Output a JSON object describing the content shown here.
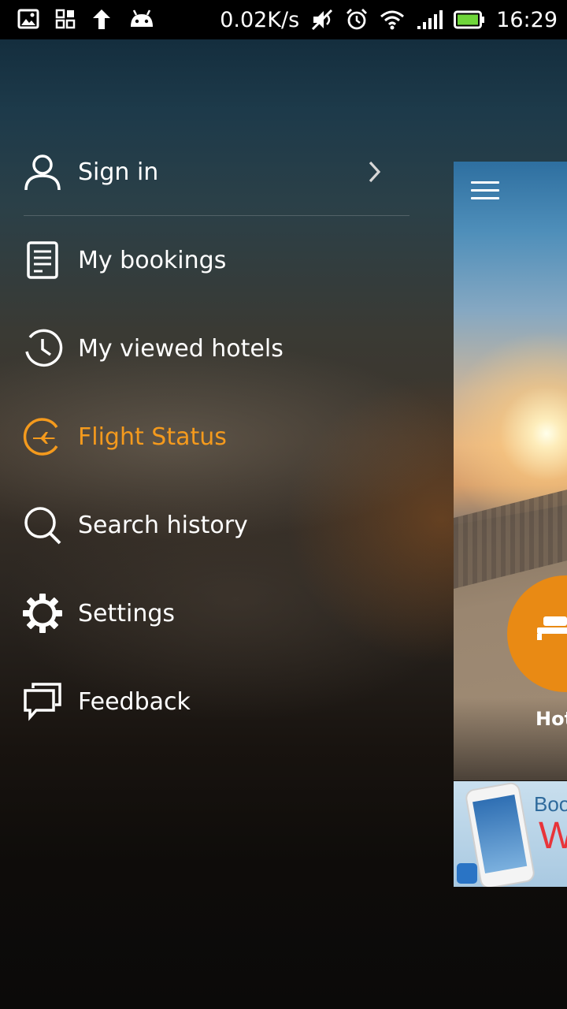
{
  "status_bar": {
    "speed": "0.02K/s",
    "time": "16:29",
    "left_icons": [
      "image-notification-icon",
      "app-notification-icon",
      "upload-icon",
      "android-icon"
    ],
    "right_icons": [
      "mute-icon",
      "alarm-icon",
      "wifi-icon",
      "signal-icon",
      "battery-icon"
    ]
  },
  "drawer": {
    "items": [
      {
        "label": "Sign in",
        "icon": "user-icon"
      },
      {
        "label": "My bookings",
        "icon": "bookings-icon"
      },
      {
        "label": "My viewed hotels",
        "icon": "clock-icon"
      },
      {
        "label": "Flight Status",
        "icon": "flight-icon",
        "active": true
      },
      {
        "label": "Search history",
        "icon": "search-icon"
      },
      {
        "label": "Settings",
        "icon": "gear-icon"
      },
      {
        "label": "Feedback",
        "icon": "feedback-icon"
      }
    ]
  },
  "preview": {
    "hotel_label": "Hot",
    "ad_text_line1": "Book",
    "ad_text_line2": "W"
  },
  "colors": {
    "accent": "#f49a1d",
    "hotel_button": "#e98a14",
    "text": "#ffffff"
  }
}
